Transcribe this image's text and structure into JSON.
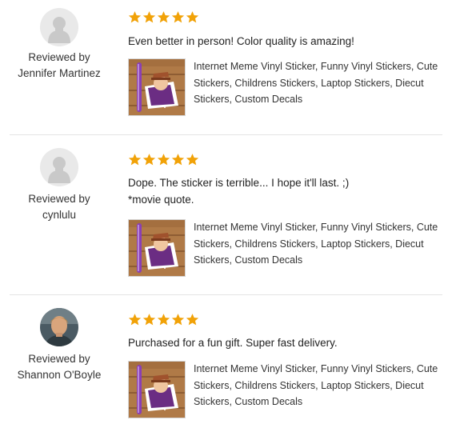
{
  "reviews": [
    {
      "rating": 5,
      "reviewed_by_label": "Reviewed by",
      "reviewer_name": "Jennifer Martinez",
      "avatar": "default-avatar-icon",
      "text_lines": [
        "Even better in person! Color quality is amazing!"
      ],
      "listing_title": "Internet Meme Vinyl Sticker, Funny Vinyl Stickers, Cute Stickers, Childrens Stickers, Laptop Stickers, Diecut Stickers, Custom Decals"
    },
    {
      "rating": 5,
      "reviewed_by_label": "Reviewed by",
      "reviewer_name": "cynlulu",
      "avatar": "default-avatar-icon",
      "text_lines": [
        "Dope. The sticker is terrible... I hope it'll last. ;)",
        "*movie quote."
      ],
      "listing_title": "Internet Meme Vinyl Sticker, Funny Vinyl Stickers, Cute Stickers, Childrens Stickers, Laptop Stickers, Diecut Stickers, Custom Decals"
    },
    {
      "rating": 5,
      "reviewed_by_label": "Reviewed by",
      "reviewer_name": "Shannon O'Boyle",
      "avatar": "user-photo",
      "text_lines": [
        "Purchased for a fun gift. Super fast delivery."
      ],
      "listing_title": "Internet Meme Vinyl Sticker, Funny Vinyl Stickers, Cute Stickers, Childrens Stickers, Laptop Stickers, Diecut Stickers, Custom Decals"
    }
  ],
  "colors": {
    "star": "#f1a208",
    "divider": "#e3e3e3",
    "text": "#222222"
  }
}
